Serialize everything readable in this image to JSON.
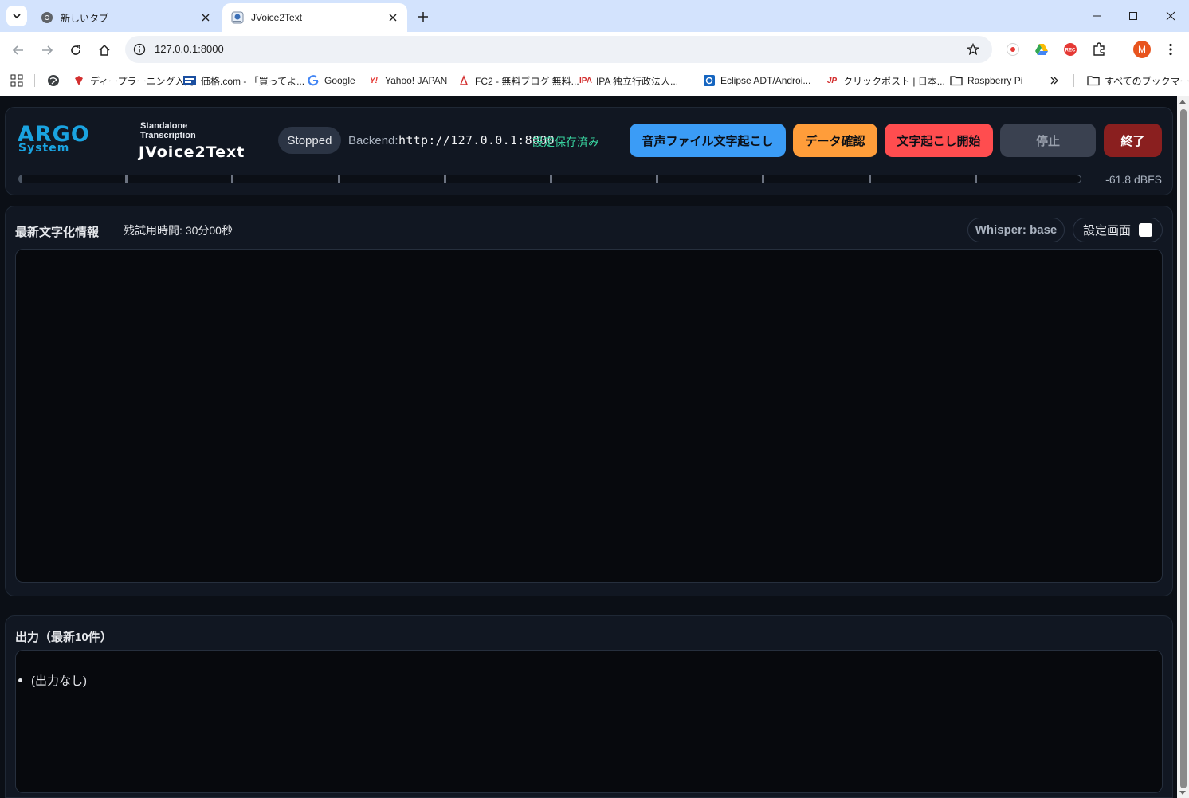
{
  "browser": {
    "tabs": [
      {
        "title": "新しいタブ",
        "active": false
      },
      {
        "title": "JVoice2Text",
        "active": true
      }
    ],
    "url": "127.0.0.1:8000",
    "profile_initial": "M",
    "bookmarks": [
      {
        "label": "ディープラーニング入門",
        "icon": "crystal-icon"
      },
      {
        "label": "価格.com - 「買ってよ...",
        "icon": "kakaku-icon"
      },
      {
        "label": "Google",
        "icon": "google-icon"
      },
      {
        "label": "Yahoo! JAPAN",
        "icon": "yahoo-icon"
      },
      {
        "label": "FC2 - 無料ブログ 無料...",
        "icon": "fc2-icon"
      },
      {
        "label": "IPA 独立行政法人...",
        "icon": "ipa-icon",
        "prefix": "IPA"
      },
      {
        "label": "Eclipse ADT/Androi...",
        "icon": "eclipse-icon"
      },
      {
        "label": "クリックポスト | 日本...",
        "icon": "jp-post-icon",
        "prefix": "JP"
      },
      {
        "label": "Raspberry Pi",
        "icon": "folder-icon"
      }
    ],
    "all_bookmarks_label": "すべてのブックマーク"
  },
  "app": {
    "logo_top": "ARGO",
    "logo_bottom": "System",
    "subtitle_line1": "Standalone",
    "subtitle_line2": "Transcription",
    "title": "JVoice2Text",
    "status": "Stopped",
    "backend_label": "Backend:",
    "backend_url": "http://127.0.0.1:8000",
    "saved_label": "設定保存済み",
    "buttons": {
      "file": "音声ファイル文字起こし",
      "data": "データ確認",
      "start": "文字起こし開始",
      "stop": "停止",
      "exit": "終了"
    },
    "level_db": "-61.8 dBFS",
    "level_fraction": 0.002,
    "info": {
      "title": "最新文字化情報",
      "trial_time": "残試用時間: 30分00秒",
      "model": "Whisper: base",
      "settings_label": "設定画面",
      "settings_checked": false
    },
    "output": {
      "title": "出力（最新10件）",
      "items": [
        "(出力なし)"
      ]
    }
  },
  "colors": {
    "accent_blue": "#3b9cf6",
    "accent_orange": "#ff9d3a",
    "accent_red": "#ff4d4f",
    "exit_red": "#8a1f1f",
    "saved_green": "#38d39f"
  }
}
